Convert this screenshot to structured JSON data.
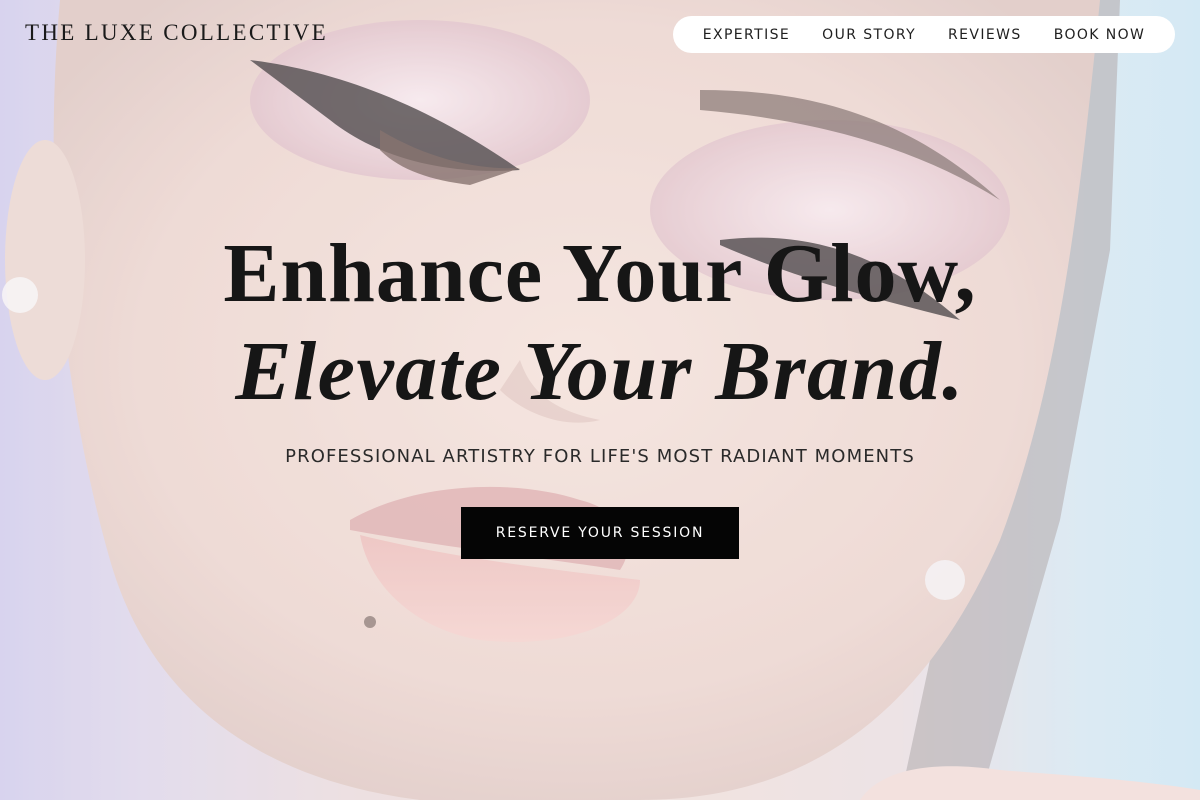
{
  "header": {
    "brand": "THE LUXE COLLECTIVE",
    "nav": [
      {
        "label": "EXPERTISE"
      },
      {
        "label": "OUR STORY"
      },
      {
        "label": "REVIEWS"
      },
      {
        "label": "BOOK NOW"
      }
    ]
  },
  "hero": {
    "title_line1": "Enhance Your Glow,",
    "title_line2": "Elevate Your Brand.",
    "subtitle": "PROFESSIONAL ARTISTRY FOR LIFE'S MOST RADIANT MOMENTS",
    "cta_label": "RESERVE YOUR SESSION",
    "background_image": "close-up portrait of a woman with winged eyeliner, pink eyeshadow and pink lips"
  },
  "colors": {
    "text": "#161616",
    "nav_bg": "#ffffff",
    "cta_bg": "#050505",
    "cta_text": "#ffffff"
  }
}
